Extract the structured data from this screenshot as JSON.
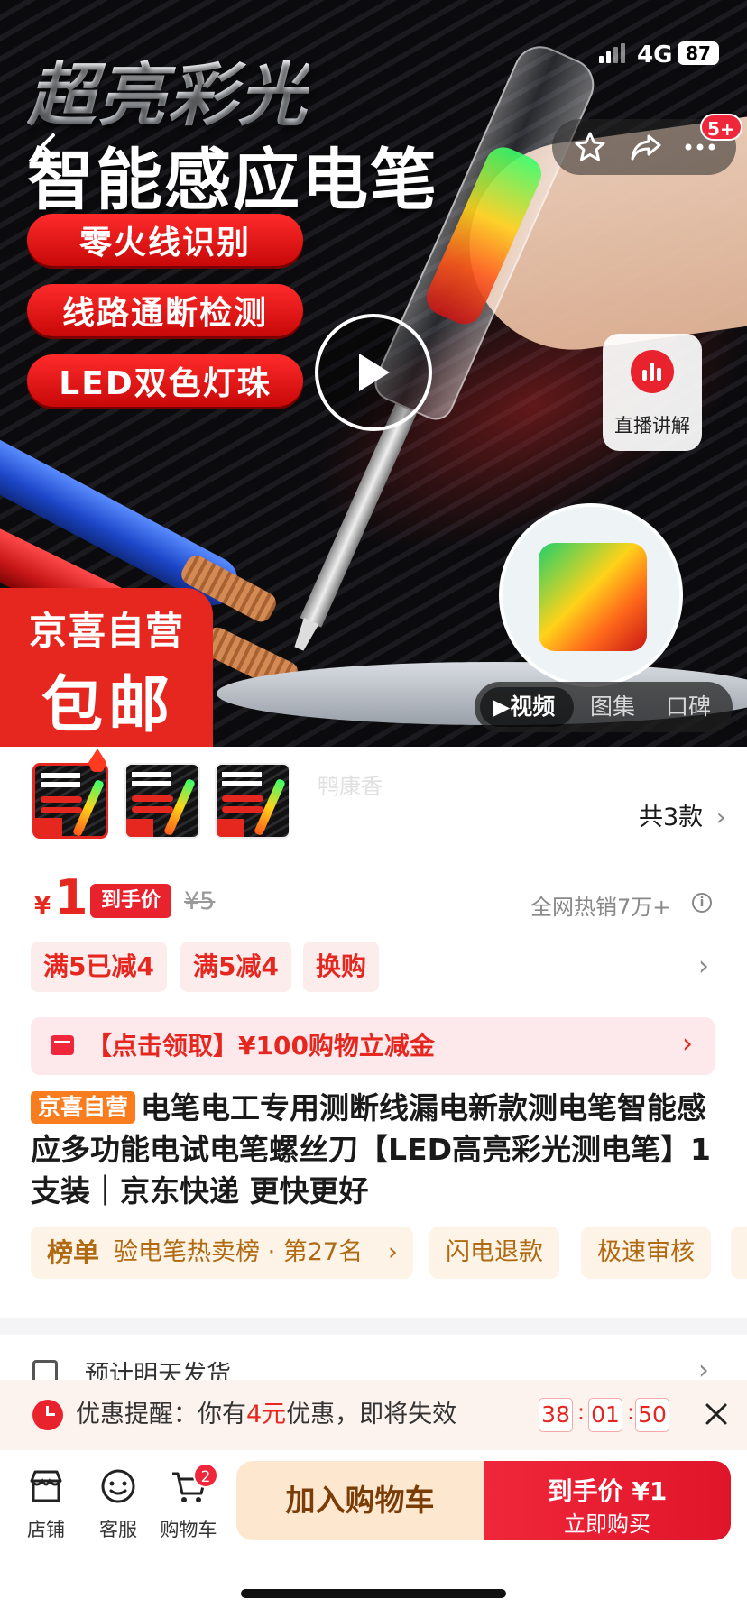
{
  "status_bar": {
    "network": "4G",
    "battery": "87"
  },
  "hero": {
    "headline_1": "超亮彩光",
    "headline_2": "智能感应电笔",
    "features": [
      "零火线识别",
      "线路通断检测",
      "LED双色灯珠"
    ],
    "badge_line1": "京喜自营",
    "badge_line2": "包邮",
    "nav_badge": "5+",
    "live_label": "直播讲解",
    "media_tabs": [
      "▶视频",
      "图集",
      "口碑"
    ],
    "media_active": 0
  },
  "variants": {
    "watermark": "鸭康香",
    "count_label": "共3款"
  },
  "price": {
    "currency": "¥",
    "value": "1",
    "tag": "到手价",
    "original": "¥5",
    "sales": "全网热销7万+"
  },
  "promos": [
    "满5已减4",
    "满5减4",
    "换购"
  ],
  "coupon": {
    "text": "【点击领取】¥100购物立减金"
  },
  "title": {
    "tag": "京喜自营",
    "text": "电笔电工专用测断线漏电新款测电笔智能感应多功能电试电笔螺丝刀【LED高亮彩光测电笔】1支装｜京东快递 更快更好"
  },
  "rank": {
    "label": "榜单",
    "desc": "验电笔热卖榜 · 第27名"
  },
  "services": [
    "闪电退款",
    "极速审核"
  ],
  "shipping": {
    "text": "预计明天发货"
  },
  "reminder": {
    "prefix": "优惠提醒：你有",
    "amount": "4元",
    "suffix": "优惠，即将失效",
    "countdown": [
      "38",
      "01",
      "50"
    ]
  },
  "bottom_bar": {
    "store": "店铺",
    "service": "客服",
    "cart": "购物车",
    "cart_count": "2",
    "add_to_cart": "加入购物车",
    "buy_price": "到手价 ¥1",
    "buy_now": "立即购买"
  },
  "colors": {
    "brand_red": "#e5271f",
    "accent_orange": "#f97c1e",
    "pill_bg": "#fdf3e6"
  }
}
